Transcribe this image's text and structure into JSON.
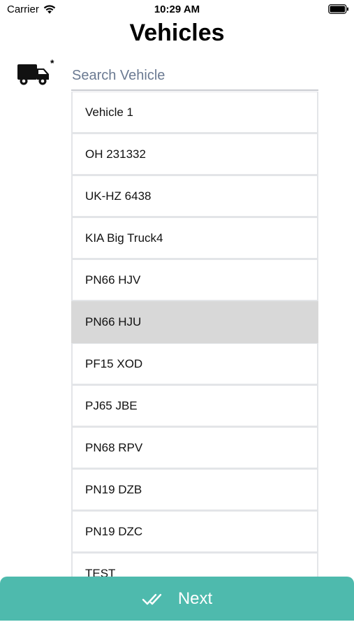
{
  "status_bar": {
    "carrier": "Carrier",
    "time": "10:29 AM",
    "wifi_icon": "wifi-icon",
    "battery_icon": "battery-icon"
  },
  "header": {
    "title": "Vehicles"
  },
  "search": {
    "icon": "truck-icon",
    "required_mark": "*",
    "placeholder": "Search Vehicle",
    "value": ""
  },
  "vehicles": {
    "selected": "PN66 HJU",
    "items": [
      {
        "label": "Vehicle 1"
      },
      {
        "label": "OH 231332"
      },
      {
        "label": "UK-HZ 6438"
      },
      {
        "label": "KIA Big Truck4"
      },
      {
        "label": "PN66 HJV"
      },
      {
        "label": "PN66 HJU"
      },
      {
        "label": "PF15 XOD"
      },
      {
        "label": "PJ65 JBE"
      },
      {
        "label": "PN68 RPV"
      },
      {
        "label": "PN19 DZB"
      },
      {
        "label": "PN19 DZC"
      },
      {
        "label": "TEST"
      }
    ]
  },
  "footer": {
    "next_label": "Next",
    "next_icon": "double-check-icon"
  },
  "colors": {
    "accent": "#4ebaad",
    "selected_row": "#d8d8d8",
    "placeholder": "#6b7a92"
  }
}
